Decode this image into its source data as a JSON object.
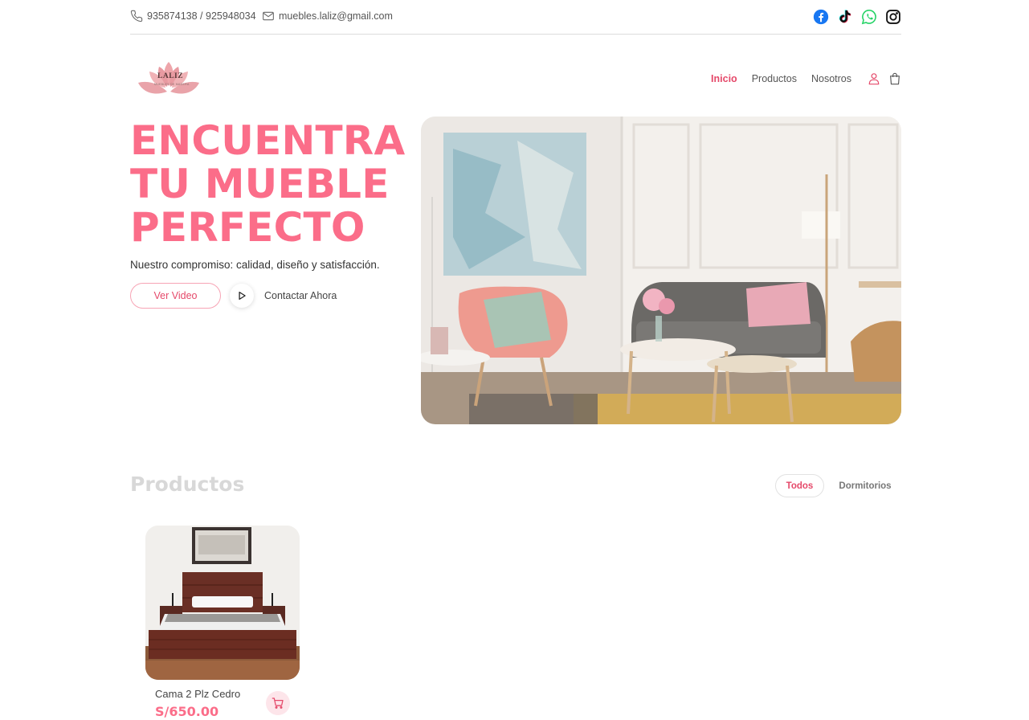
{
  "topbar": {
    "phone": "935874138 / 925948034",
    "email": "muebles.laliz@gmail.com",
    "socials": [
      "facebook-icon",
      "tiktok-icon",
      "whatsapp-icon",
      "instagram-icon"
    ]
  },
  "brand": {
    "name": "LALIZ",
    "tagline": "MUEBLES DE MADERA"
  },
  "nav": {
    "items": [
      {
        "label": "Inicio",
        "active": true
      },
      {
        "label": "Productos",
        "active": false
      },
      {
        "label": "Nosotros",
        "active": false
      }
    ],
    "icons": [
      "user-icon",
      "shopping-bag-icon"
    ]
  },
  "hero": {
    "title_lines": [
      "ENCUENTRA",
      "TU MUEBLE",
      "PERFECTO"
    ],
    "subtitle": "Nuestro compromiso: calidad, diseño y satisfacción.",
    "video_button": "Ver Video",
    "contact_link": "Contactar Ahora"
  },
  "products": {
    "title": "Productos",
    "filters": [
      {
        "label": "Todos",
        "active": true
      },
      {
        "label": "Dormitorios",
        "active": false
      }
    ],
    "items": [
      {
        "name": "Cama 2 Plz Cedro",
        "price": "S/650.00"
      }
    ]
  },
  "colors": {
    "accent": "#fb6d89",
    "accent_dark": "#e5496a",
    "muted_heading": "#d8d8d8"
  }
}
